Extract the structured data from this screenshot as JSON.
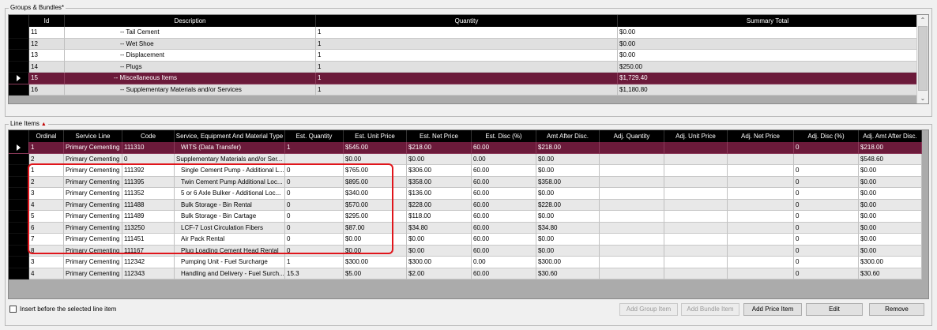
{
  "groups": {
    "title": "Groups & Bundles*",
    "columns": [
      "Id",
      "Description",
      "Quantity",
      "Summary Total"
    ],
    "rows": [
      {
        "id": "11",
        "desc": "-- Tail Cement",
        "qty": "1",
        "total": "$0.00",
        "selected": false
      },
      {
        "id": "12",
        "desc": "-- Wet Shoe",
        "qty": "1",
        "total": "$0.00",
        "selected": false
      },
      {
        "id": "13",
        "desc": "-- Displacement",
        "qty": "1",
        "total": "$0.00",
        "selected": false
      },
      {
        "id": "14",
        "desc": "-- Plugs",
        "qty": "1",
        "total": "$250.00",
        "selected": false
      },
      {
        "id": "15",
        "desc": "-- Miscellaneous Items",
        "qty": "1",
        "total": "$1,729.40",
        "selected": true
      },
      {
        "id": "16",
        "desc": "-- Supplementary Materials and/or Services",
        "qty": "1",
        "total": "$1,180.80",
        "selected": false
      }
    ]
  },
  "lines": {
    "title": "Line Items",
    "columns": [
      "Ordinal",
      "Service Line",
      "Code",
      "Service, Equipment And Material Type",
      "Est. Quantity",
      "Est. Unit Price",
      "Est. Net Price",
      "Est. Disc (%)",
      "Amt After Disc.",
      "Adj. Quantity",
      "Adj. Unit Price",
      "Adj. Net Price",
      "Adj. Disc (%)",
      "Adj. Amt After Disc."
    ],
    "rows": [
      [
        "1",
        "Primary Cementing",
        "111310",
        "WITS (Data Transfer)",
        "1",
        "$545.00",
        "$218.00",
        "60.00",
        "$218.00",
        "",
        "",
        "",
        "0",
        "$218.00"
      ],
      [
        "2",
        "Primary Cementing",
        "0",
        "Supplementary Materials and/or Ser...",
        "",
        "$0.00",
        "$0.00",
        "0.00",
        "$0.00",
        "",
        "",
        "",
        "",
        "$548.60"
      ],
      [
        "1",
        "Primary Cementing",
        "111392",
        "Single Cement Pump - Additional L...",
        "0",
        "$765.00",
        "$306.00",
        "60.00",
        "$0.00",
        "",
        "",
        "",
        "0",
        "$0.00"
      ],
      [
        "2",
        "Primary Cementing",
        "111395",
        "Twin Cement Pump Additional Loc...",
        "0",
        "$895.00",
        "$358.00",
        "60.00",
        "$358.00",
        "",
        "",
        "",
        "0",
        "$0.00"
      ],
      [
        "3",
        "Primary Cementing",
        "111352",
        "5 or 6 Axle Bulker - Additional Loc...",
        "0",
        "$340.00",
        "$136.00",
        "60.00",
        "$0.00",
        "",
        "",
        "",
        "0",
        "$0.00"
      ],
      [
        "4",
        "Primary Cementing",
        "111488",
        "Bulk Storage - Bin Rental",
        "0",
        "$570.00",
        "$228.00",
        "60.00",
        "$228.00",
        "",
        "",
        "",
        "0",
        "$0.00"
      ],
      [
        "5",
        "Primary Cementing",
        "111489",
        "Bulk Storage - Bin Cartage",
        "0",
        "$295.00",
        "$118.00",
        "60.00",
        "$0.00",
        "",
        "",
        "",
        "0",
        "$0.00"
      ],
      [
        "6",
        "Primary Cementing",
        "113250",
        "LCF-7 Lost Circulation Fibers",
        "0",
        "$87.00",
        "$34.80",
        "60.00",
        "$34.80",
        "",
        "",
        "",
        "0",
        "$0.00"
      ],
      [
        "7",
        "Primary Cementing",
        "111451",
        "Air Pack Rental",
        "0",
        "$0.00",
        "$0.00",
        "60.00",
        "$0.00",
        "",
        "",
        "",
        "0",
        "$0.00"
      ],
      [
        "8",
        "Primary Cementing",
        "111167",
        "Plug Loading Cement Head Rental",
        "0",
        "$0.00",
        "$0.00",
        "60.00",
        "$0.00",
        "",
        "",
        "",
        "0",
        "$0.00"
      ],
      [
        "3",
        "Primary Cementing",
        "112342",
        "Pumping Unit - Fuel Surcharge",
        "1",
        "$300.00",
        "$300.00",
        "0.00",
        "$300.00",
        "",
        "",
        "",
        "0",
        "$300.00"
      ],
      [
        "4",
        "Primary Cementing",
        "112343",
        "Handling and Delivery - Fuel Surch...",
        "15.3",
        "$5.00",
        "$2.00",
        "60.00",
        "$30.60",
        "",
        "",
        "",
        "0",
        "$30.60"
      ]
    ]
  },
  "footer": {
    "insert_label": "Insert before the selected line item",
    "add_group": "Add Group Item",
    "add_bundle": "Add Bundle Item",
    "add_price": "Add Price Item",
    "edit": "Edit",
    "remove": "Remove"
  },
  "colors": {
    "selected_row": "#6b1a3a",
    "highlight_border": "#e0151b"
  }
}
